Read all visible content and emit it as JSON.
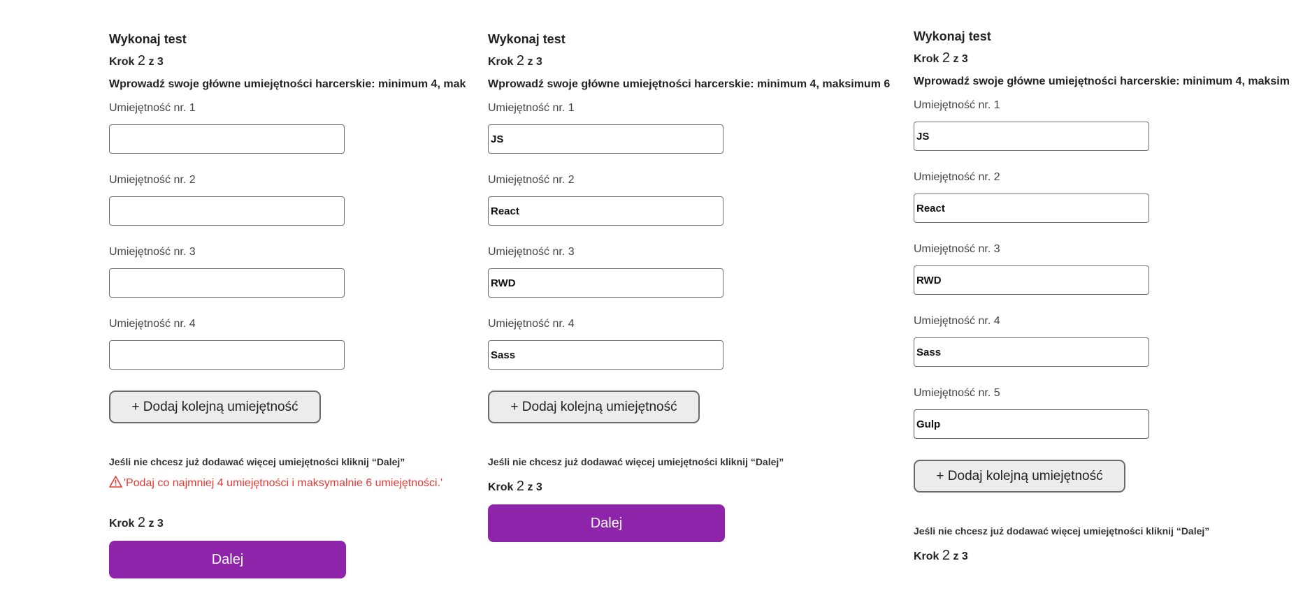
{
  "common": {
    "title": "Wykonaj test",
    "step_prefix": "Krok",
    "step_current": "2",
    "step_suffix": "z 3",
    "instruction": "Wprowadź swoje główne umiejętności harcerskie: minimum 4, maksimum 6",
    "skill_labels": [
      "Umiejętność nr. 1",
      "Umiejętność nr. 2",
      "Umiejętność nr. 3",
      "Umiejętność nr. 4",
      "Umiejętność nr. 5"
    ],
    "add_button": "+ Dodaj kolejną umiejętność",
    "hint": "Jeśli nie chcesz już dodawać więcej umiejętności kliknij “Dalej”",
    "next_button": "Dalej"
  },
  "panel1": {
    "instruction_visible": "Wprowadź swoje główne umiejętności harcerskie: minimum 4, mak",
    "skills": [
      "",
      "",
      "",
      ""
    ],
    "error": "'Podaj co najmniej 4 umiejętności i maksymalnie 6 umiejętności.'"
  },
  "panel2": {
    "skills": [
      "JS",
      "React",
      "RWD",
      "Sass"
    ]
  },
  "panel3": {
    "instruction_visible": "Wprowadź swoje główne umiejętności harcerskie: minimum 4, maksim",
    "skills": [
      "JS",
      "React",
      "RWD",
      "Sass",
      "Gulp"
    ]
  },
  "colors": {
    "primary": "#8e24aa",
    "error": "#e53935",
    "add_button_bg": "#ececec"
  }
}
